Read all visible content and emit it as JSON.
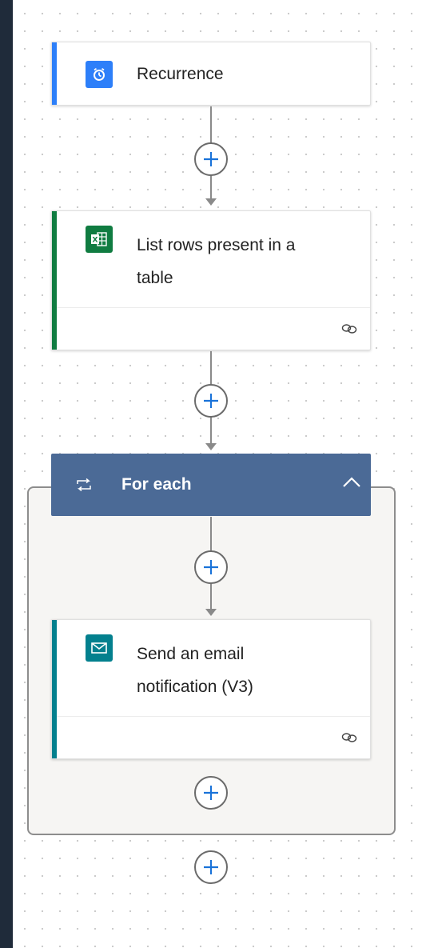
{
  "flow": {
    "recurrence": {
      "title": "Recurrence",
      "icon": "alarm-clock-icon",
      "accent": "#2d7ff9"
    },
    "list_rows": {
      "title_line1": "List rows present in a",
      "title_line2": "table",
      "icon": "excel-icon",
      "accent": "#107c41"
    },
    "for_each": {
      "title": "For each",
      "icon": "loop-icon",
      "header_color": "#4b6a96"
    },
    "send_email": {
      "title_line1": "Send an email",
      "title_line2": "notification (V3)",
      "icon": "envelope-icon",
      "accent": "#03808e"
    }
  }
}
